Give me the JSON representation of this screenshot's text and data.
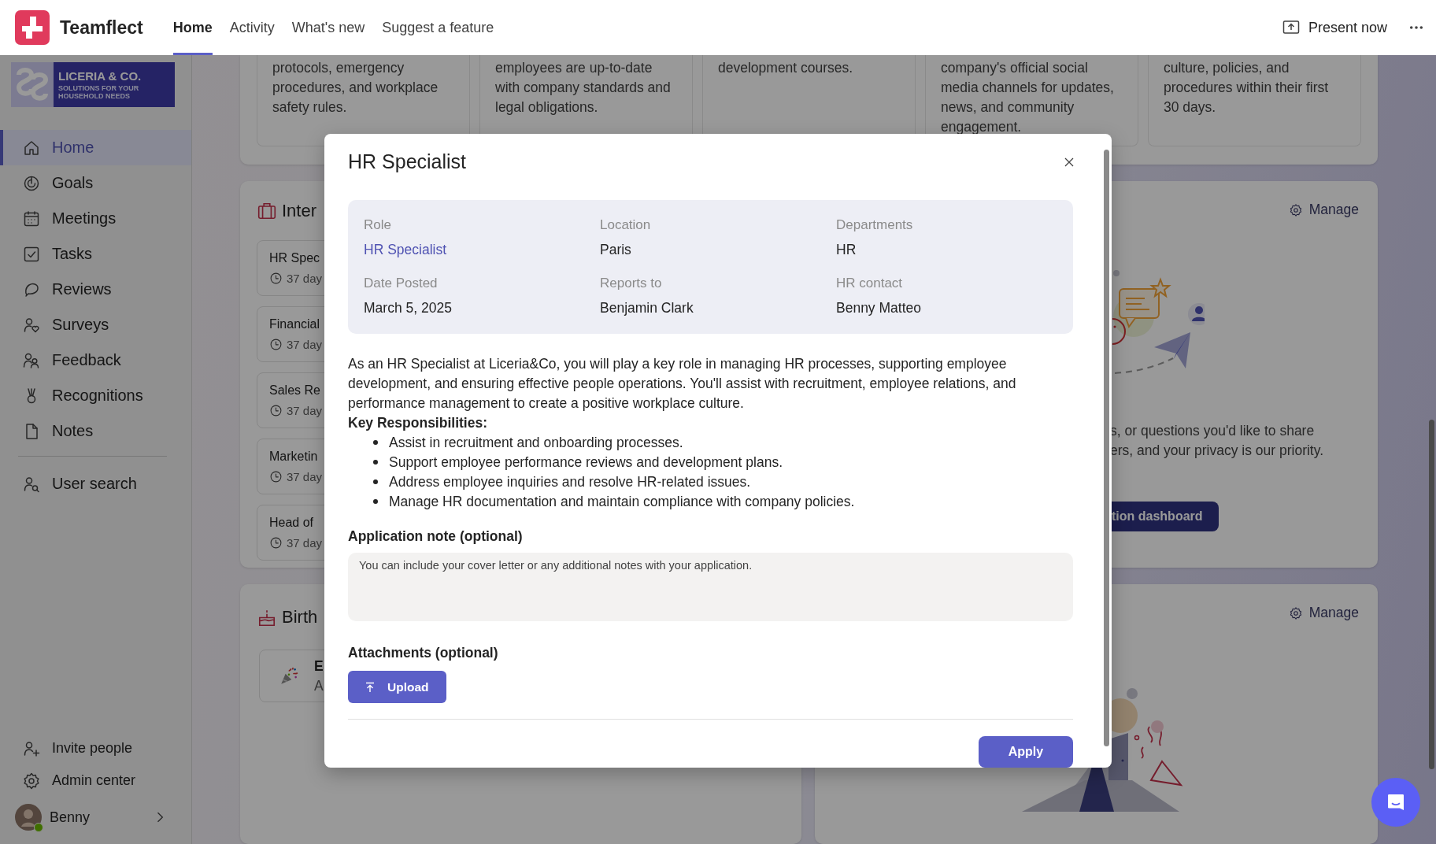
{
  "app": {
    "name": "Teamflect"
  },
  "nav_tabs": [
    {
      "label": "Home",
      "selected": true
    },
    {
      "label": "Activity",
      "selected": false
    },
    {
      "label": "What's new",
      "selected": false
    },
    {
      "label": "Suggest a feature",
      "selected": false
    }
  ],
  "present_label": "Present now",
  "sidebar": {
    "logo": {
      "name": "LICERIA & CO.",
      "tagline": "SOLUTIONS FOR YOUR HOUSEHOLD NEEDS"
    },
    "items": [
      {
        "label": "Home",
        "selected": true
      },
      {
        "label": "Goals",
        "selected": false
      },
      {
        "label": "Meetings",
        "selected": false
      },
      {
        "label": "Tasks",
        "selected": false
      },
      {
        "label": "Reviews",
        "selected": false
      },
      {
        "label": "Surveys",
        "selected": false
      },
      {
        "label": "Feedback",
        "selected": false
      },
      {
        "label": "Recognitions",
        "selected": false
      },
      {
        "label": "Notes",
        "selected": false
      }
    ],
    "secondary": [
      {
        "label": "User search"
      }
    ],
    "footer": [
      {
        "label": "Invite people"
      },
      {
        "label": "Admin center"
      }
    ],
    "user": {
      "name": "Benny",
      "online": true
    }
  },
  "info_cards": [
    {
      "text": "protocols, emergency\nprocedures, and workplace\nsafety rules."
    },
    {
      "text": "employees are up-to-date\nwith company standards and\nlegal obligations."
    },
    {
      "text": "development courses."
    },
    {
      "text": "company's official social\nmedia channels for updates,\nnews, and community\nengagement."
    },
    {
      "text": "culture, policies, and\nprocedures within their first\n30 days."
    }
  ],
  "internal_panel": {
    "title": "Inter",
    "jobs": [
      {
        "title": "HR Spec",
        "posted": "37 day"
      },
      {
        "title": "Financial",
        "posted": "37 day"
      },
      {
        "title": "Sales Re",
        "posted": "37 day"
      },
      {
        "title": "Marketin",
        "posted": "37 day"
      },
      {
        "title": "Head of",
        "posted": "37 day"
      }
    ]
  },
  "feedback_panel": {
    "manage": "Manage",
    "lines": [
      "s, or questions you'd like to share",
      "ers, and your privacy is our priority."
    ],
    "button": "tion dashboard"
  },
  "birthday_panel": {
    "title": "Birth",
    "entry": {
      "name": "E",
      "detail": "A"
    }
  },
  "celebration_panel": {
    "manage": "Manage"
  },
  "modal": {
    "title": "HR Specialist",
    "fields": [
      {
        "label": "Role",
        "value": "HR Specialist",
        "kind": "link"
      },
      {
        "label": "Location",
        "value": "Paris",
        "kind": "text"
      },
      {
        "label": "Departments",
        "value": "HR",
        "kind": "text"
      },
      {
        "label": "Date Posted",
        "value": "March 5, 2025",
        "kind": "text"
      },
      {
        "label": "Reports to",
        "value": "Benjamin Clark",
        "kind": "text"
      },
      {
        "label": "HR contact",
        "value": "Benny Matteo",
        "kind": "text"
      }
    ],
    "description": "As an HR Specialist at Liceria&Co, you will play a key role in managing HR processes, supporting employee development, and ensuring effective people operations. You'll assist with recruitment, employee relations, and performance management to create a positive workplace culture.",
    "responsibilities_heading": "Key Responsibilities:",
    "responsibilities": [
      "Assist in recruitment and onboarding processes.",
      "Support employee performance reviews and development plans.",
      "Address employee inquiries and resolve HR-related issues.",
      "Manage HR documentation and maintain compliance with company policies."
    ],
    "note_label": "Application note (optional)",
    "note": {
      "placeholder": "You can include your cover letter or any additional notes with your application."
    },
    "attachments_label": "Attachments (optional)",
    "upload": "Upload",
    "apply": "Apply"
  }
}
